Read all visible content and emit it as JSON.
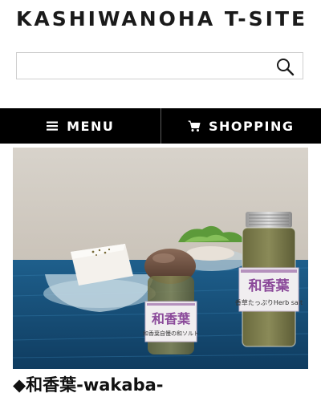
{
  "header": {
    "site_title": "KASHIWANOHA T-SITE"
  },
  "search": {
    "placeholder": "",
    "value": "",
    "icon": "search-icon"
  },
  "nav": {
    "items": [
      {
        "label": "MENU",
        "icon": "hamburger-icon"
      },
      {
        "label": "SHOPPING",
        "icon": "cart-icon"
      }
    ],
    "background": "#000000",
    "text_color": "#ffffff"
  },
  "hero": {
    "jar_left_label": "和香葉",
    "jar_left_sublabel": "和香葉自慢の和ソルト",
    "jar_right_label": "和香葉",
    "jar_right_sublabel": "香草たっぷりHerb salt"
  },
  "article": {
    "title": "◆和香葉-wakaba-"
  }
}
